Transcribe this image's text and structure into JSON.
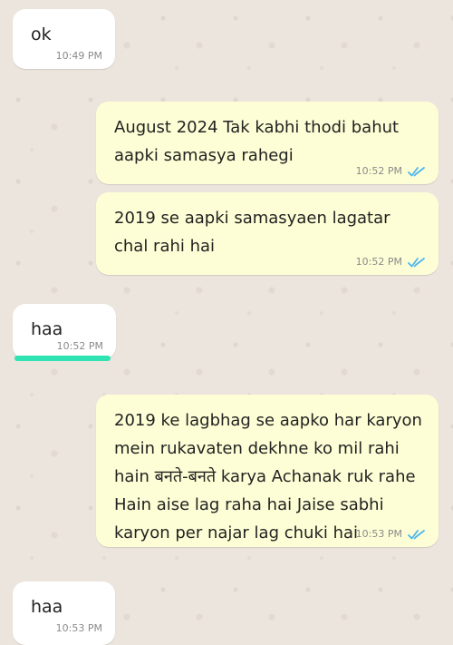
{
  "messages": [
    {
      "direction": "incoming",
      "text": "ok",
      "time": "10:49 PM"
    },
    {
      "direction": "outgoing",
      "text": "August 2024 Tak kabhi thodi bahut aapki samasya rahegi",
      "time": "10:52 PM",
      "status": "read-double-tick"
    },
    {
      "direction": "outgoing",
      "text": "2019 se aapki samasyaen lagatar chal rahi hai",
      "time": "10:52 PM",
      "status": "read-double-tick"
    },
    {
      "direction": "incoming",
      "text": "haa",
      "time": "10:52 PM"
    },
    {
      "direction": "outgoing",
      "text": "2019 ke lagbhag se aapko har karyon mein rukavaten dekhne ko mil rahi hain बनते-बनते karya Achanak ruk rahe Hain aise lag raha hai Jaise sabhi karyon per najar lag chuki hai",
      "time": "10:53 PM",
      "status": "read-double-tick"
    },
    {
      "direction": "incoming",
      "text": "haa",
      "time": "10:53 PM"
    }
  ],
  "colors": {
    "wallpaper": "#ece5dd",
    "incoming_bubble": "#ffffff",
    "outgoing_bubble": "#fefed6",
    "read_tick": "#4fb6ec",
    "highlight_underline": "#2fe3b2"
  },
  "icons": {
    "status": "double-check-icon"
  }
}
